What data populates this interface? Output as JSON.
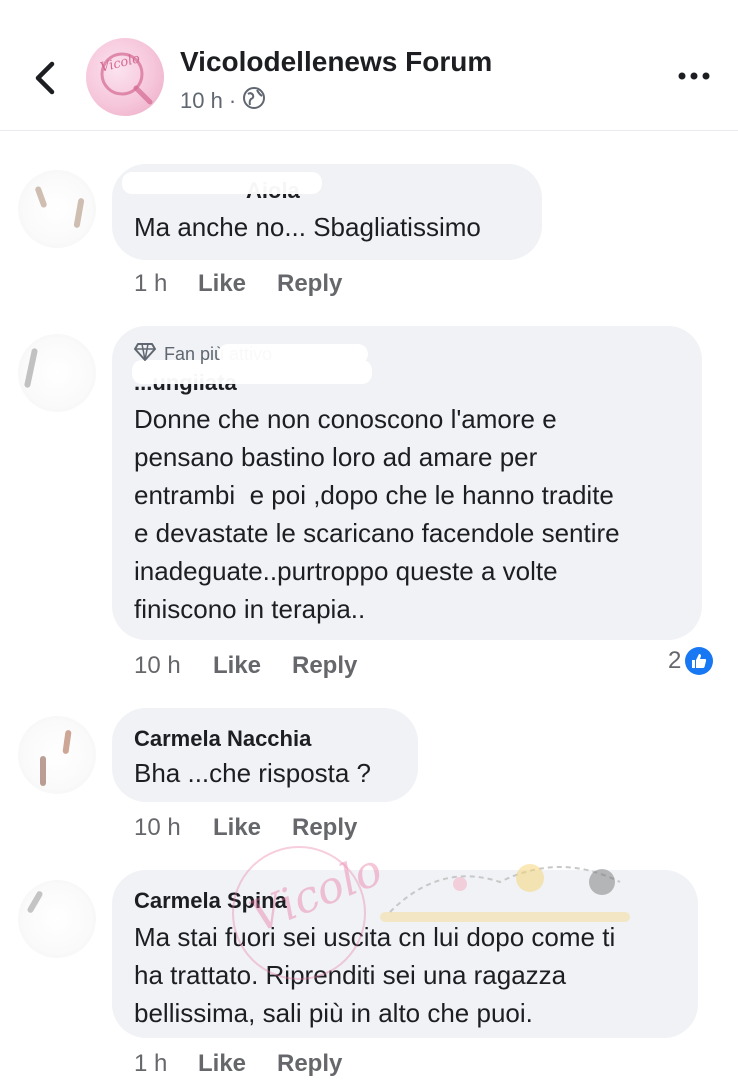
{
  "header": {
    "page_name": "Vicolodellenews Forum",
    "post_time": "10 h",
    "separator": "·",
    "avatar_text": "Vicolo"
  },
  "badge": {
    "fan_label": "Fan più attivo"
  },
  "comments": [
    {
      "author": "Aiola",
      "text": "Ma anche no... Sbagliatissimo",
      "time": "1 h",
      "like": "Like",
      "reply": "Reply"
    },
    {
      "author": "...ungiiata",
      "text": "Donne che non conoscono l'amore e\npensano bastino loro ad amare per\nentrambi  e poi ,dopo che le hanno tradite\ne devastate le scaricano facendole sentire\ninadeguate..purtroppo queste a volte\nfiniscono in terapia..",
      "time": "10 h",
      "like": "Like",
      "reply": "Reply",
      "reactions": "2"
    },
    {
      "author": "Carmela Nacchia",
      "text": "Bha ...che risposta ?",
      "time": "10 h",
      "like": "Like",
      "reply": "Reply"
    },
    {
      "author": "Carmela Spina",
      "text": "Ma stai fuori sei uscita cn lui dopo come ti\nha trattato. Riprenditi sei una ragazza\nbellissima, sali più in alto che puoi.",
      "time": "1 h",
      "like": "Like",
      "reply": "Reply"
    }
  ],
  "watermark": {
    "text": "Vicolo"
  },
  "colors": {
    "bubble": "#f0f2f5",
    "meta": "#65676b",
    "like_blue": "#1877f2"
  }
}
